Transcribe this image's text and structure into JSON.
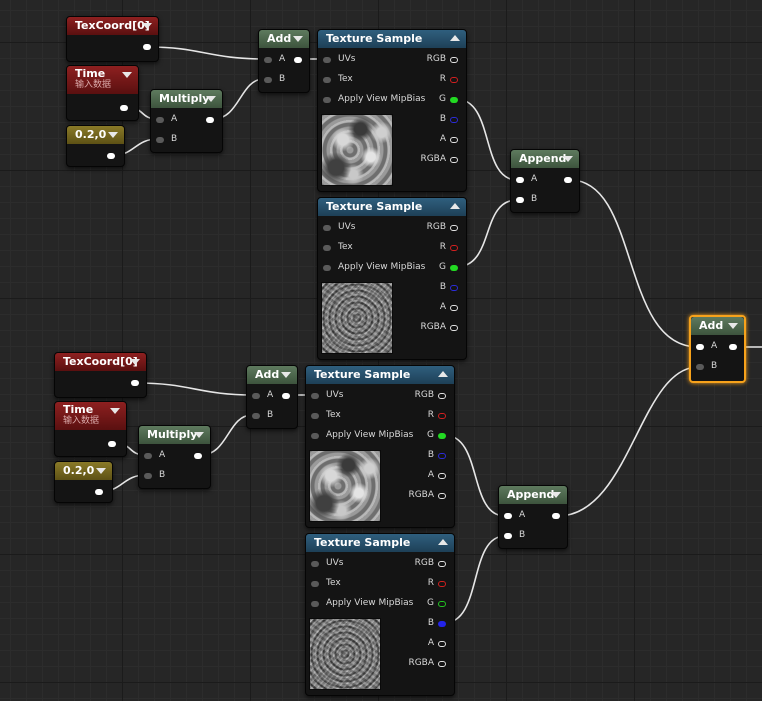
{
  "graph": {
    "nodes": {
      "texcoord_top": {
        "title": "TexCoord[0]"
      },
      "time_top": {
        "title": "Time",
        "subtitle": "输入数据"
      },
      "const_top": {
        "title": "0.2,0"
      },
      "multiply_top": {
        "title": "Multiply",
        "in_a": "A",
        "in_b": "B"
      },
      "add_top": {
        "title": "Add",
        "in_a": "A",
        "in_b": "B"
      },
      "texsample_1": {
        "title": "Texture Sample",
        "in_uvs": "UVs",
        "in_tex": "Tex",
        "in_mip": "Apply View MipBias",
        "out_rgb": "RGB",
        "out_r": "R",
        "out_g": "G",
        "out_b": "B",
        "out_a": "A",
        "out_rgba": "RGBA"
      },
      "texsample_2": {
        "title": "Texture Sample",
        "in_uvs": "UVs",
        "in_tex": "Tex",
        "in_mip": "Apply View MipBias",
        "out_rgb": "RGB",
        "out_r": "R",
        "out_g": "G",
        "out_b": "B",
        "out_a": "A",
        "out_rgba": "RGBA"
      },
      "append_top": {
        "title": "Append",
        "in_a": "A",
        "in_b": "B"
      },
      "add_final": {
        "title": "Add",
        "in_a": "A",
        "in_b": "B",
        "selected": true
      },
      "texcoord_bottom": {
        "title": "TexCoord[0]"
      },
      "time_bottom": {
        "title": "Time",
        "subtitle": "输入数据"
      },
      "const_bottom": {
        "title": "0.2,0"
      },
      "multiply_bottom": {
        "title": "Multiply",
        "in_a": "A",
        "in_b": "B"
      },
      "add_bottom": {
        "title": "Add",
        "in_a": "A",
        "in_b": "B"
      },
      "texsample_3": {
        "title": "Texture Sample",
        "in_uvs": "UVs",
        "in_tex": "Tex",
        "in_mip": "Apply View MipBias",
        "out_rgb": "RGB",
        "out_r": "R",
        "out_g": "G",
        "out_b": "B",
        "out_a": "A",
        "out_rgba": "RGBA"
      },
      "texsample_4": {
        "title": "Texture Sample",
        "in_uvs": "UVs",
        "in_tex": "Tex",
        "in_mip": "Apply View MipBias",
        "out_rgb": "RGB",
        "out_r": "R",
        "out_g": "G",
        "out_b": "B",
        "out_a": "A",
        "out_rgba": "RGBA"
      },
      "append_bottom": {
        "title": "Append",
        "in_a": "A",
        "in_b": "B"
      }
    },
    "colors": {
      "background": "#262626",
      "texture_header": "#2f5f7e",
      "math_header": "#5e7a5e",
      "time_header": "#8e2020",
      "constant_header": "#8a7a28",
      "selection": "#f7a21b",
      "wire": "#e6e6e6"
    }
  }
}
